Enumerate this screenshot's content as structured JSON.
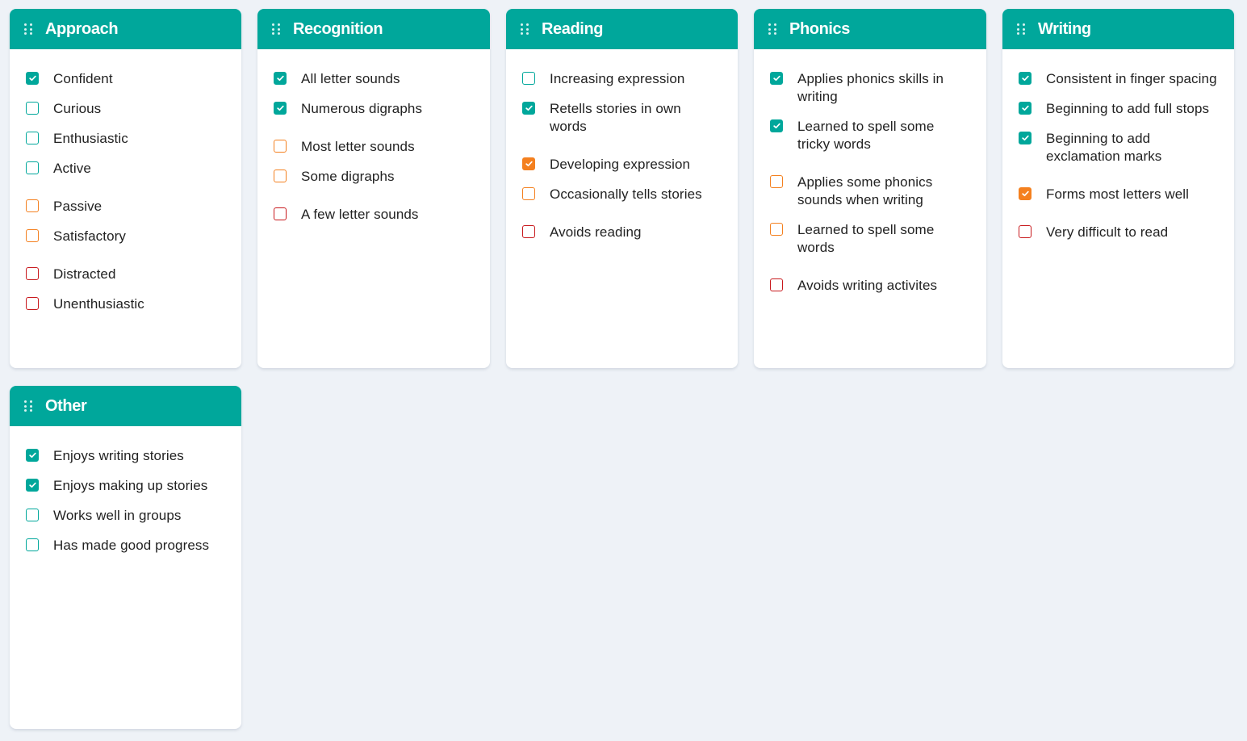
{
  "colors": {
    "background": "#eef2f7",
    "header": "#00a79b",
    "positive": "#00a79b",
    "neutral": "#f4801f",
    "negative": "#c8191d"
  },
  "cards": [
    {
      "title": "Approach",
      "items": [
        {
          "label": "Confident",
          "level": "teal",
          "checked": true,
          "gap": false
        },
        {
          "label": "Curious",
          "level": "teal",
          "checked": false,
          "gap": false
        },
        {
          "label": "Enthusiastic",
          "level": "teal",
          "checked": false,
          "gap": false
        },
        {
          "label": "Active",
          "level": "teal",
          "checked": false,
          "gap": false
        },
        {
          "label": "Passive",
          "level": "orange",
          "checked": false,
          "gap": true
        },
        {
          "label": "Satisfactory",
          "level": "orange",
          "checked": false,
          "gap": false
        },
        {
          "label": "Distracted",
          "level": "red",
          "checked": false,
          "gap": true
        },
        {
          "label": "Unenthusiastic",
          "level": "red",
          "checked": false,
          "gap": false
        }
      ]
    },
    {
      "title": "Recognition",
      "items": [
        {
          "label": "All letter sounds",
          "level": "teal",
          "checked": true,
          "gap": false
        },
        {
          "label": "Numerous digraphs",
          "level": "teal",
          "checked": true,
          "gap": false
        },
        {
          "label": "Most letter sounds",
          "level": "orange",
          "checked": false,
          "gap": true
        },
        {
          "label": "Some digraphs",
          "level": "orange",
          "checked": false,
          "gap": false
        },
        {
          "label": "A few letter sounds",
          "level": "red",
          "checked": false,
          "gap": true
        }
      ]
    },
    {
      "title": "Reading",
      "items": [
        {
          "label": "Increasing expression",
          "level": "teal",
          "checked": false,
          "gap": false
        },
        {
          "label": "Retells stories in own words",
          "level": "teal",
          "checked": true,
          "gap": false
        },
        {
          "label": "Developing expression",
          "level": "orange",
          "checked": true,
          "gap": true
        },
        {
          "label": "Occasionally tells stories",
          "level": "orange",
          "checked": false,
          "gap": false
        },
        {
          "label": "Avoids reading",
          "level": "red",
          "checked": false,
          "gap": true
        }
      ]
    },
    {
      "title": "Phonics",
      "items": [
        {
          "label": "Applies phonics skills in writing",
          "level": "teal",
          "checked": true,
          "gap": false
        },
        {
          "label": "Learned to spell some tricky words",
          "level": "teal",
          "checked": true,
          "gap": false
        },
        {
          "label": "Applies some phonics sounds when writing",
          "level": "orange",
          "checked": false,
          "gap": true
        },
        {
          "label": "Learned to spell some words",
          "level": "orange",
          "checked": false,
          "gap": false
        },
        {
          "label": "Avoids writing activites",
          "level": "red",
          "checked": false,
          "gap": true
        }
      ]
    },
    {
      "title": "Writing",
      "items": [
        {
          "label": "Consistent in finger spacing",
          "level": "teal",
          "checked": true,
          "gap": false
        },
        {
          "label": "Beginning to add full stops",
          "level": "teal",
          "checked": true,
          "gap": false
        },
        {
          "label": "Beginning to add exclamation marks",
          "level": "teal",
          "checked": true,
          "gap": false
        },
        {
          "label": "Forms most letters well",
          "level": "orange",
          "checked": true,
          "gap": true
        },
        {
          "label": "Very difficult to read",
          "level": "red",
          "checked": false,
          "gap": true
        }
      ]
    },
    {
      "title": "Other",
      "items": [
        {
          "label": "Enjoys writing stories",
          "level": "teal",
          "checked": true,
          "gap": false
        },
        {
          "label": "Enjoys making up stories",
          "level": "teal",
          "checked": true,
          "gap": false
        },
        {
          "label": "Works well in groups",
          "level": "teal",
          "checked": false,
          "gap": false
        },
        {
          "label": "Has made good progress",
          "level": "teal",
          "checked": false,
          "gap": false
        }
      ]
    }
  ]
}
